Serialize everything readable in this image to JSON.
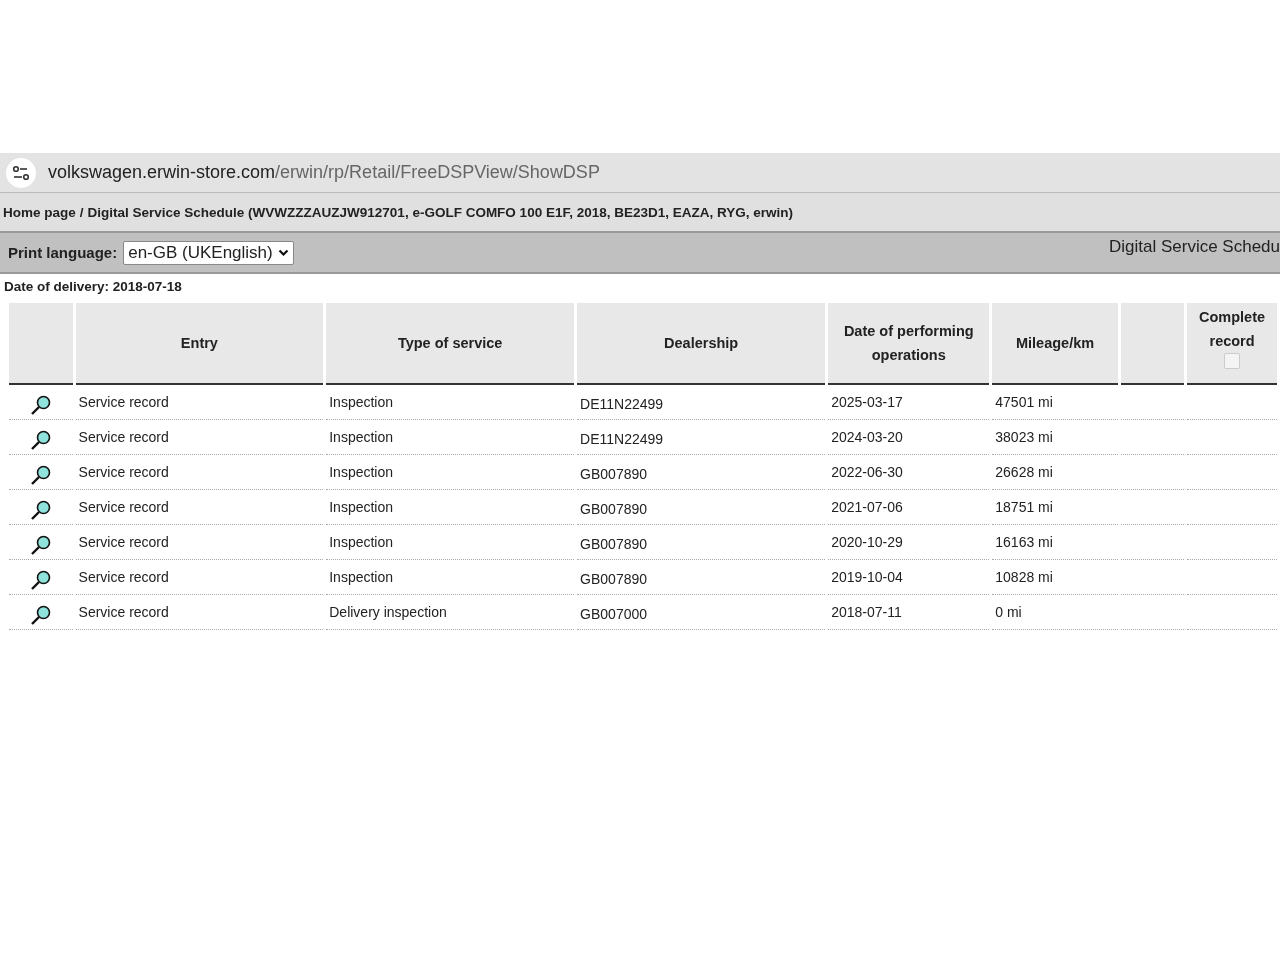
{
  "address_bar": {
    "domain": "volkswagen.erwin-store.com",
    "path": "/erwin/rp/Retail/FreeDSPView/ShowDSP"
  },
  "breadcrumb": {
    "home": "Home page",
    "separator": "/",
    "current": "Digital Service Schedule (WVWZZZAUZJW912701, e-GOLF COMFO 100 E1F, 2018, BE23D1, EAZA, RYG, erwin)"
  },
  "toolbar": {
    "print_language_label": "Print language:",
    "print_language_value": "en-GB (UKEnglish)",
    "title": "Digital Service Schedu"
  },
  "date_of_delivery": "Date of delivery: 2018-07-18",
  "table": {
    "columns": [
      "Entry",
      "Type of service",
      "Dealership",
      "Date of performing operations",
      "Mileage/km"
    ],
    "complete_record": {
      "label": "Complete record",
      "checked": false
    },
    "rows": [
      {
        "entry": "Service record",
        "type": "Inspection",
        "dealership": "DE11N22499",
        "date": "2025-03-17",
        "mileage": "47501 mi"
      },
      {
        "entry": "Service record",
        "type": "Inspection",
        "dealership": "DE11N22499",
        "date": "2024-03-20",
        "mileage": "38023 mi"
      },
      {
        "entry": "Service record",
        "type": "Inspection",
        "dealership": "GB007890",
        "date": "2022-06-30",
        "mileage": "26628 mi"
      },
      {
        "entry": "Service record",
        "type": "Inspection",
        "dealership": "GB007890",
        "date": "2021-07-06",
        "mileage": "18751 mi"
      },
      {
        "entry": "Service record",
        "type": "Inspection",
        "dealership": "GB007890",
        "date": "2020-10-29",
        "mileage": "16163 mi"
      },
      {
        "entry": "Service record",
        "type": "Inspection",
        "dealership": "GB007890",
        "date": "2019-10-04",
        "mileage": "10828 mi"
      },
      {
        "entry": "Service record",
        "type": "Delivery inspection",
        "dealership": "GB007000",
        "date": "2018-07-11",
        "mileage": "0 mi"
      }
    ]
  }
}
